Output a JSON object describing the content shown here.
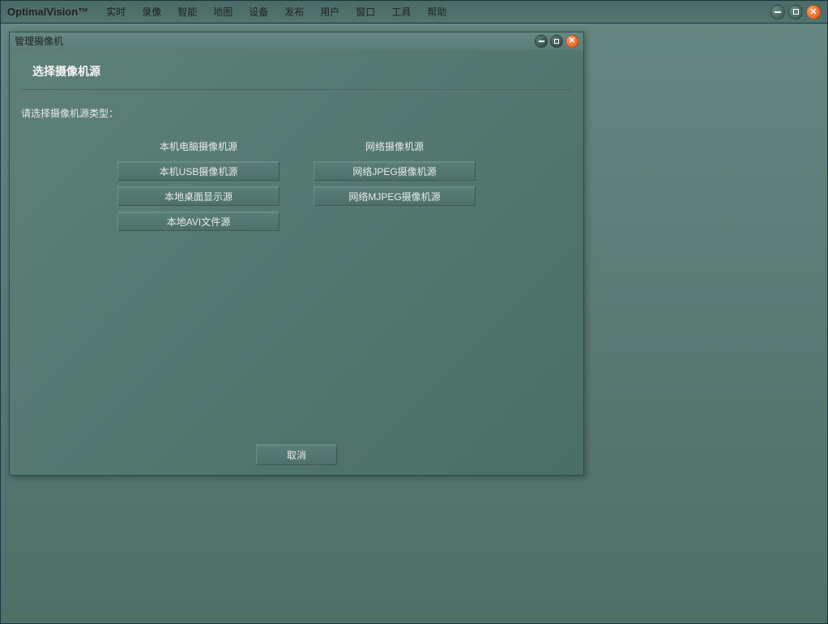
{
  "app": {
    "title": "OptimalVision™"
  },
  "menu": {
    "items": [
      "实时",
      "录像",
      "智能",
      "地图",
      "设备",
      "发布",
      "用户",
      "窗口",
      "工具",
      "帮助"
    ]
  },
  "dialog": {
    "title": "管理摄像机",
    "header": "选择摄像机源",
    "prompt": "请选择摄像机源类型：",
    "local": {
      "header": "本机电脑摄像机源",
      "options": [
        "本机USB摄像机源",
        "本地桌面显示源",
        "本地AVI文件源"
      ]
    },
    "network": {
      "header": "网络摄像机源",
      "options": [
        "网络JPEG摄像机源",
        "网络MJPEG摄像机源"
      ]
    },
    "cancel": "取消"
  }
}
